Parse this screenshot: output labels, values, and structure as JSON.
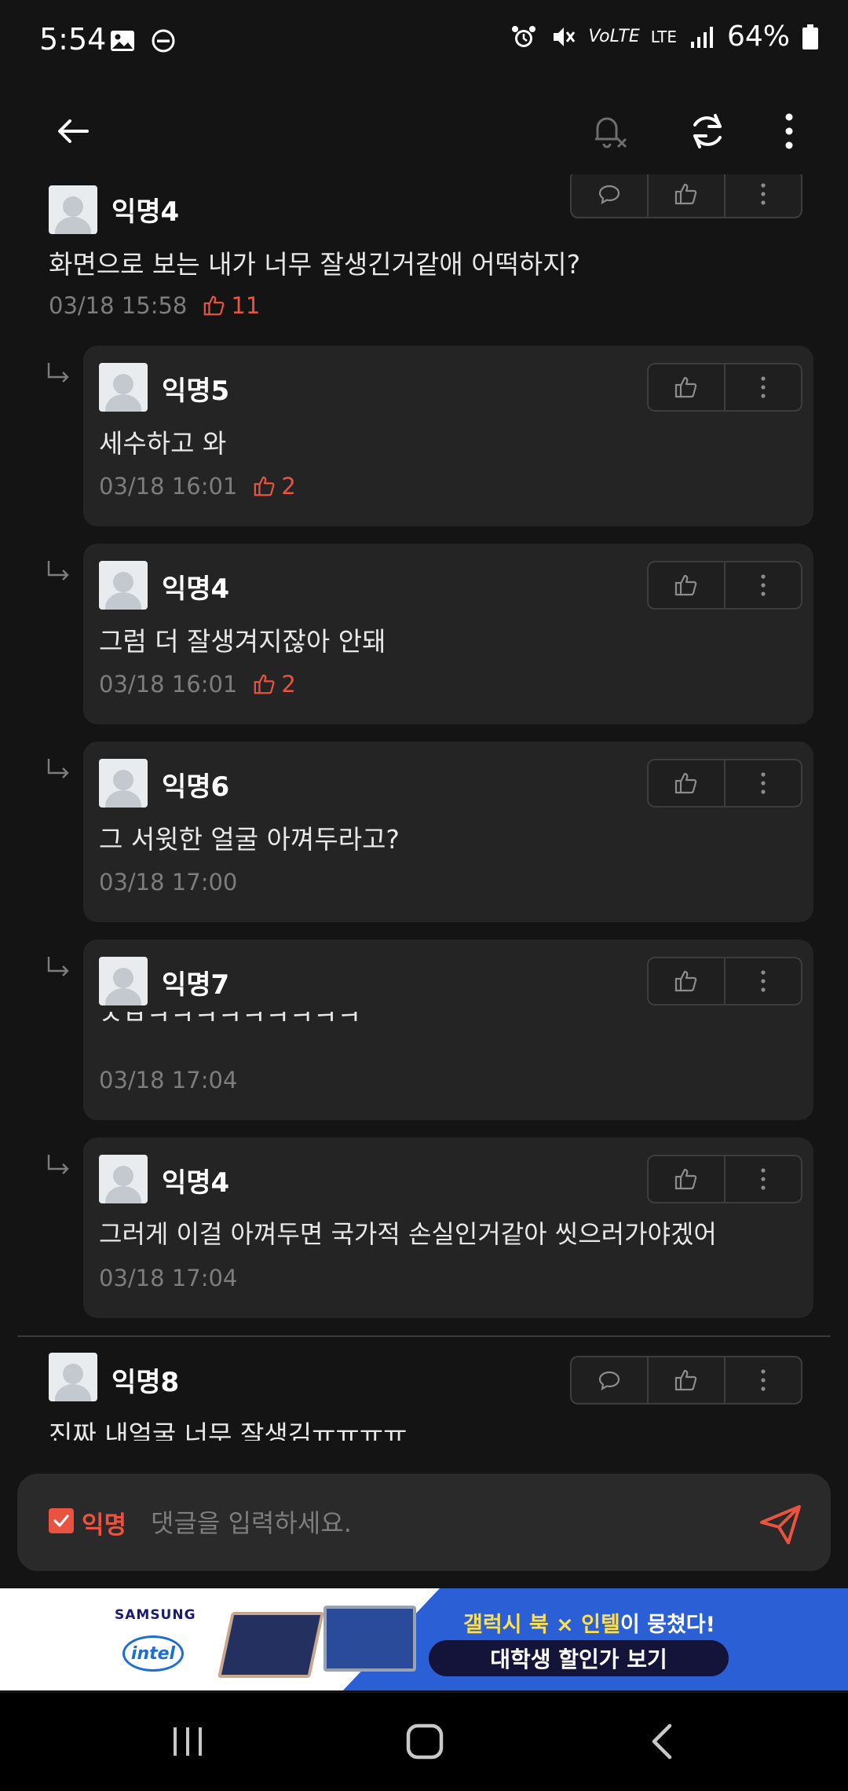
{
  "status_bar": {
    "time": "5:54",
    "battery": "64%",
    "network": "LTE",
    "volte": "VoLTE"
  },
  "colors": {
    "accent": "#e9533f",
    "background": "#141414",
    "card": "#242424",
    "muted": "#7d7d7d"
  },
  "comments": [
    {
      "author": "익명4",
      "text": "화면으로 보는 내가 너무 잘생긴거같애 어떡하지?",
      "timestamp": "03/18 15:58",
      "likes": "11"
    },
    {
      "author": "익명8",
      "text": "진짜 내얼굴 너무 잘생김ㅠㅠㅠㅠ",
      "timestamp": "",
      "likes": ""
    }
  ],
  "replies": [
    {
      "author": "익명5",
      "text": "세수하고 와",
      "timestamp": "03/18 16:01",
      "likes": "2"
    },
    {
      "author": "익명4",
      "text": "그럼 더 잘생겨지잖아 안돼",
      "timestamp": "03/18 16:01",
      "likes": "2"
    },
    {
      "author": "익명6",
      "text": "그 서윗한 얼굴 아껴두라고?",
      "timestamp": "03/18 17:00",
      "likes": ""
    },
    {
      "author": "익명7",
      "text": "ㅅㅂㅋㅋㅋㅋㅋㅋㅋㅋㅋ",
      "timestamp": "03/18 17:04",
      "likes": ""
    },
    {
      "author": "익명4",
      "text": "그러게 이걸 아껴두면 국가적 손실인거같아 씻으러가야겠어",
      "timestamp": "03/18 17:04",
      "likes": ""
    }
  ],
  "input": {
    "anon_label": "익명",
    "placeholder": "댓글을 입력하세요."
  },
  "ad": {
    "brand1": "SAMSUNG",
    "brand2": "intel",
    "headline_highlight": "갤럭시 북 × 인텔",
    "headline_rest": "이 뭉쳤다!",
    "cta": "대학생 할인가 보기"
  },
  "icons": {
    "back": "arrow-left-icon",
    "notification": "bell-off-icon",
    "refresh": "refresh-icon",
    "more": "more-vertical-icon",
    "reply_action": "chat-bubble-icon",
    "like": "thumbs-up-icon",
    "send": "paper-plane-icon"
  }
}
